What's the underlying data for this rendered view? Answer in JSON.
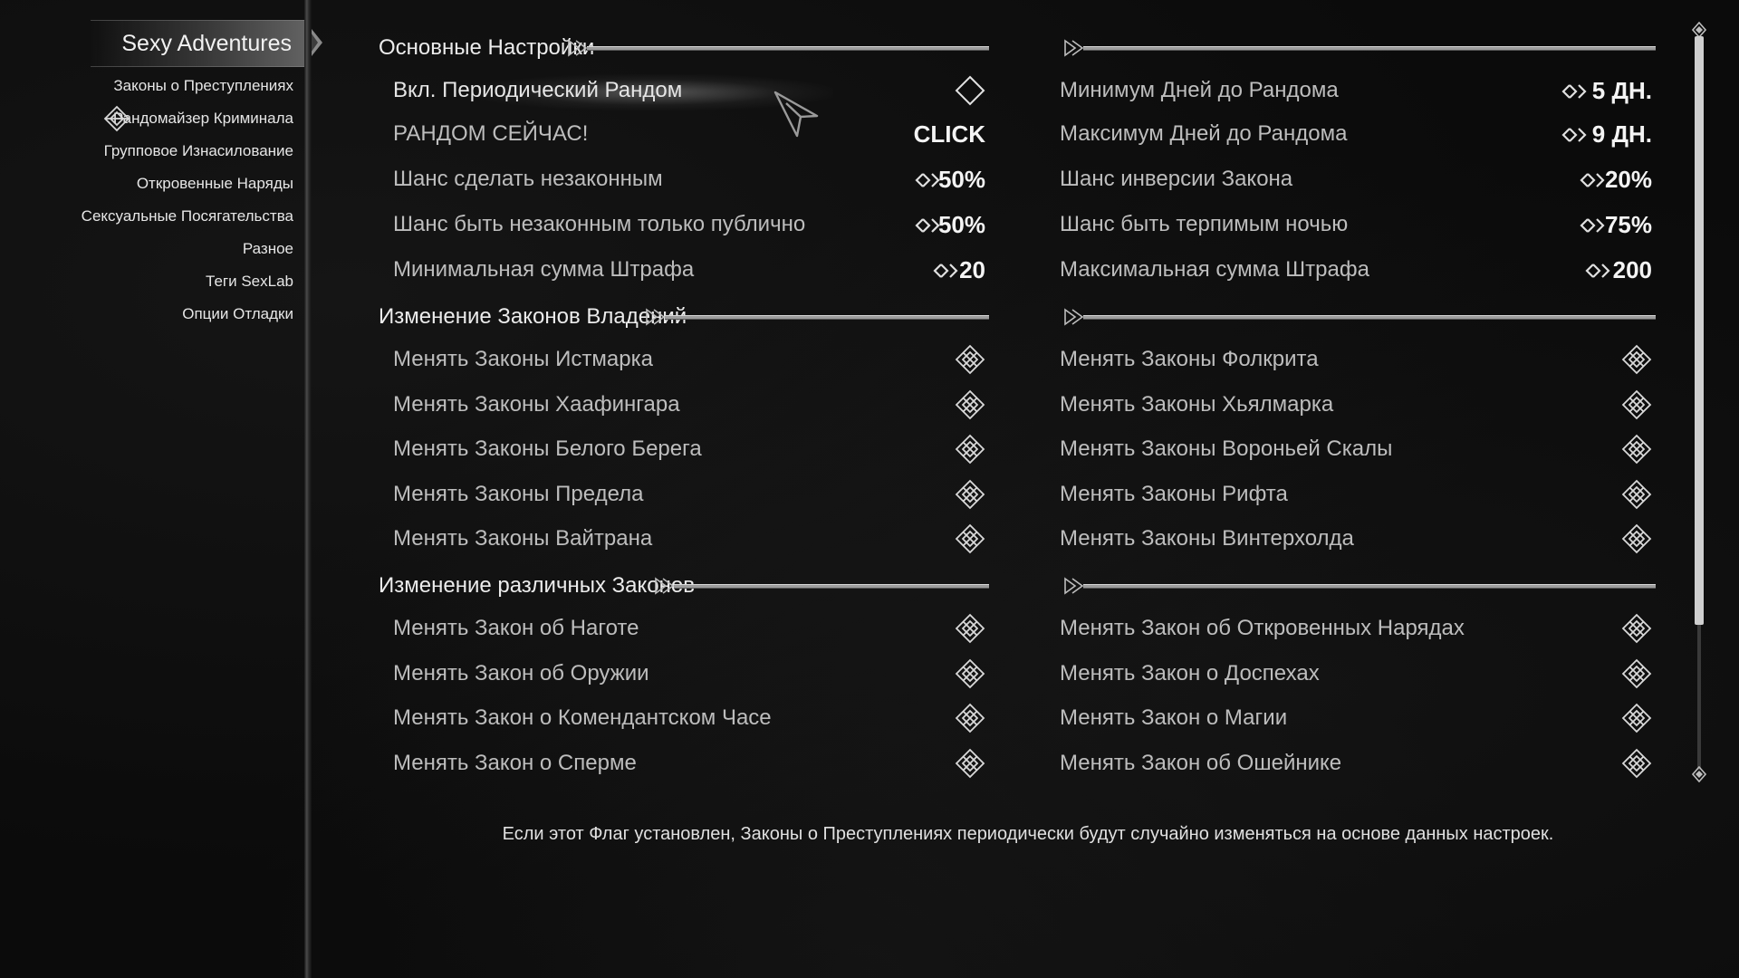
{
  "mod": {
    "title": "Sexy Adventures"
  },
  "sidebar": {
    "items": [
      {
        "label": "Законы о Преступлениях"
      },
      {
        "label": "Рандомайзер Криминала"
      },
      {
        "label": "Групповое Изнасилование"
      },
      {
        "label": "Откровенные Наряды"
      },
      {
        "label": "Сексуальные Посягательства"
      },
      {
        "label": "Разное"
      },
      {
        "label": "Теги SexLab"
      },
      {
        "label": "Опции Отладки"
      }
    ],
    "selected_index": 1
  },
  "sections": {
    "main": {
      "title": "Основные Настройки"
    },
    "holds": {
      "title": "Изменение Законов Владений"
    },
    "misc": {
      "title": "Изменение различных Законов"
    }
  },
  "left": {
    "main": [
      {
        "label": "Вкл. Периодический Рандом",
        "value": "",
        "icon": "diamond-checkbox-icon",
        "checked": false
      },
      {
        "label": "РАНДОМ СЕЙЧАС!",
        "value": "CLICK"
      },
      {
        "label": "Шанс сделать незаконным",
        "value": "50%"
      },
      {
        "label": "Шанс быть незаконным только публично",
        "value": "50%"
      },
      {
        "label": "Минимальная сумма Штрафа",
        "value": "20"
      }
    ],
    "holds": [
      {
        "label": "Менять Законы Истмарка",
        "checked": true
      },
      {
        "label": "Менять Законы Хаафингара",
        "checked": true
      },
      {
        "label": "Менять Законы Белого Берега",
        "checked": true
      },
      {
        "label": "Менять Законы Предела",
        "checked": true
      },
      {
        "label": "Менять Законы Вайтрана",
        "checked": true
      }
    ],
    "misc": [
      {
        "label": "Менять Закон об Наготе",
        "checked": true
      },
      {
        "label": "Менять Закон об Оружии",
        "checked": true
      },
      {
        "label": "Менять Закон о Комендантском Часе",
        "checked": true
      },
      {
        "label": "Менять Закон о Сперме",
        "checked": true
      }
    ]
  },
  "right": {
    "main": [
      {
        "label": "Минимум Дней до Рандома",
        "value": "5 ДН."
      },
      {
        "label": "Максимум Дней до Рандома",
        "value": "9 ДН."
      },
      {
        "label": "Шанс инверсии Закона",
        "value": "20%"
      },
      {
        "label": "Шанс быть терпимым ночью",
        "value": "75%"
      },
      {
        "label": "Максимальная сумма Штрафа",
        "value": "200"
      }
    ],
    "holds": [
      {
        "label": "Менять Законы Фолкрита",
        "checked": true
      },
      {
        "label": "Менять Законы Хьялмарка",
        "checked": true
      },
      {
        "label": "Менять Законы Вороньей Скалы",
        "checked": true
      },
      {
        "label": "Менять Законы Рифта",
        "checked": true
      },
      {
        "label": "Менять Законы Винтерхолда",
        "checked": true
      }
    ],
    "misc": [
      {
        "label": "Менять Закон об Откровенных Нарядах",
        "checked": true
      },
      {
        "label": "Менять Закон о Доспехах",
        "checked": true
      },
      {
        "label": "Менять Закон о Магии",
        "checked": true
      },
      {
        "label": "Менять Закон об Ошейнике",
        "checked": true
      }
    ]
  },
  "info": {
    "text": "Если этот Флаг установлен, Законы о Преступлениях периодически будут случайно изменяться на основе данных настроек."
  },
  "scroll": {
    "position": 0.0,
    "visible_fraction": 0.8
  }
}
